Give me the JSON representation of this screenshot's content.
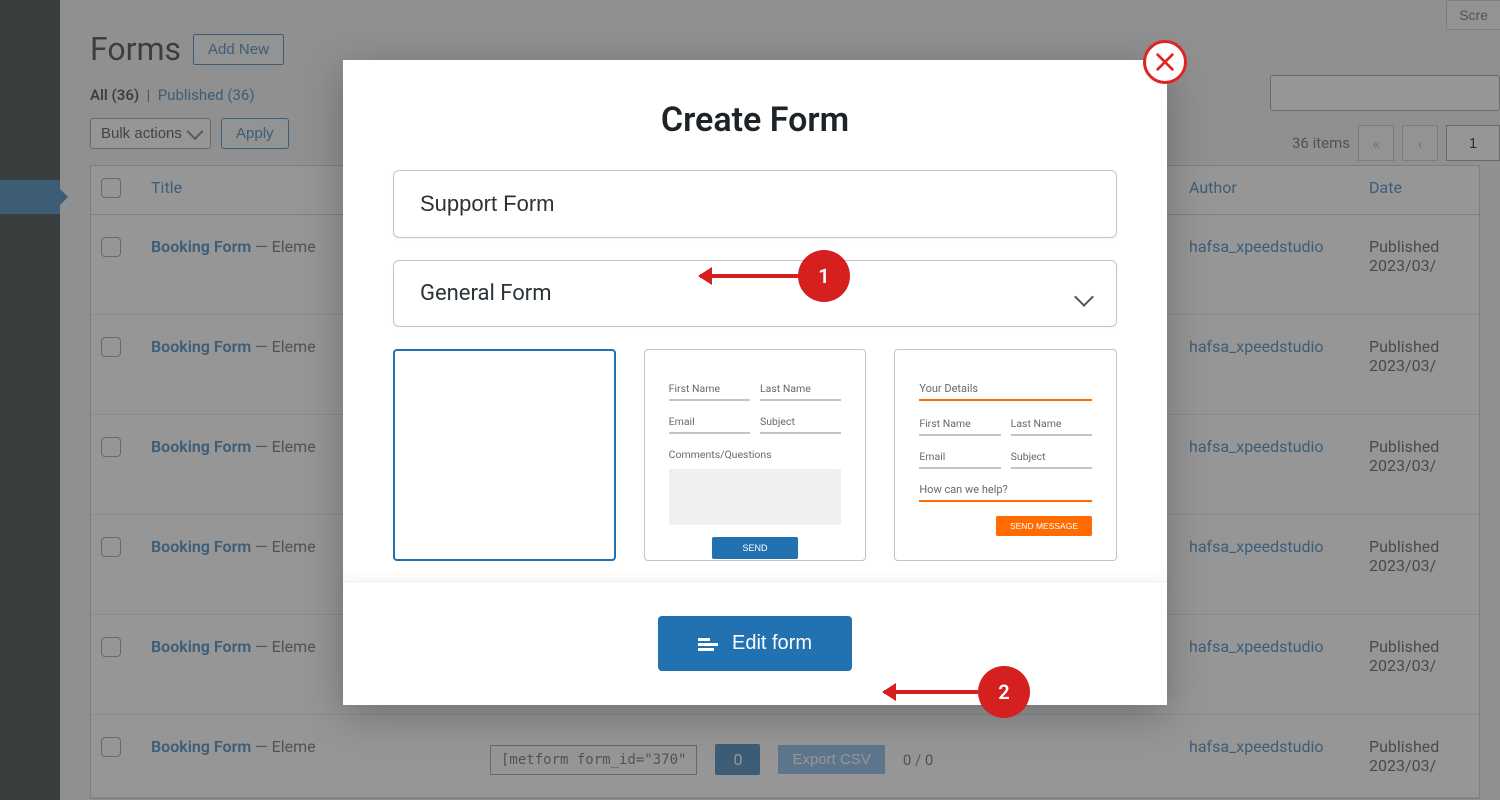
{
  "page": {
    "title": "Forms",
    "add_new": "Add New",
    "all_label": "All",
    "all_count": "(36)",
    "published_label": "Published",
    "published_count": "(36)",
    "bulk_actions": "Bulk actions",
    "apply": "Apply",
    "screen_options": "Scre",
    "items_count": "36 items",
    "page_current": "1"
  },
  "table": {
    "col_title": "Title",
    "col_author": "Author",
    "col_date": "Date",
    "rows": [
      {
        "title": "Booking Form",
        "suffix": " — Eleme",
        "author": "hafsa_xpeedstudio",
        "date_label": "Published",
        "date": "2023/03/"
      },
      {
        "title": "Booking Form",
        "suffix": " — Eleme",
        "author": "hafsa_xpeedstudio",
        "date_label": "Published",
        "date": "2023/03/"
      },
      {
        "title": "Booking Form",
        "suffix": " — Eleme",
        "author": "hafsa_xpeedstudio",
        "date_label": "Published",
        "date": "2023/03/"
      },
      {
        "title": "Booking Form",
        "suffix": " — Eleme",
        "author": "hafsa_xpeedstudio",
        "date_label": "Published",
        "date": "2023/03/"
      },
      {
        "title": "Booking Form",
        "suffix": " — Eleme",
        "author": "hafsa_xpeedstudio",
        "date_label": "Published",
        "date": "2023/03/"
      },
      {
        "title": "Booking Form",
        "suffix": " — Eleme",
        "author": "hafsa_xpeedstudio",
        "date_label": "Published",
        "date": "2023/03/"
      }
    ],
    "shortcode": "[metform form_id=\"370\"",
    "entries_count": "0",
    "export_csv": "Export CSV",
    "views": "0 / 0"
  },
  "modal": {
    "title": "Create Form",
    "name_value": "Support Form",
    "type_value": "General Form",
    "edit_button": "Edit form",
    "template2": {
      "first_name": "First Name",
      "last_name": "Last Name",
      "email": "Email",
      "subject": "Subject",
      "comments": "Comments/Questions",
      "send": "SEND"
    },
    "template3": {
      "your_details": "Your Details",
      "first_name": "First Name",
      "last_name": "Last Name",
      "email": "Email",
      "subject": "Subject",
      "help": "How can we help?",
      "send": "SEND MESSAGE"
    }
  },
  "annotations": {
    "a1": "1",
    "a2": "2"
  },
  "pagination": {
    "first": "«",
    "prev": "‹"
  }
}
